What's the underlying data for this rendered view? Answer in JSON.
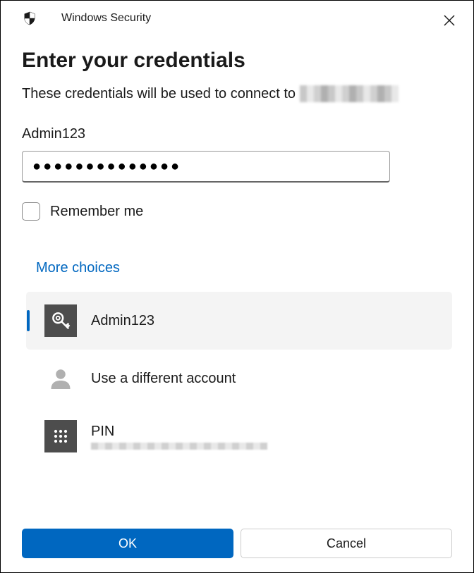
{
  "window": {
    "title": "Windows Security"
  },
  "heading": "Enter your credentials",
  "description_prefix": "These credentials will be used to connect to",
  "form": {
    "username": "Admin123",
    "password_mask": "●●●●●●●●●●●●●●",
    "remember_label": "Remember me",
    "remember_checked": false
  },
  "more_choices_label": "More choices",
  "choices": [
    {
      "label": "Admin123",
      "icon": "key",
      "selected": true
    },
    {
      "label": "Use a different account",
      "icon": "user",
      "selected": false
    },
    {
      "label": "PIN",
      "icon": "pin-pad",
      "selected": false
    }
  ],
  "buttons": {
    "ok": "OK",
    "cancel": "Cancel"
  },
  "colors": {
    "accent": "#0067c0"
  }
}
